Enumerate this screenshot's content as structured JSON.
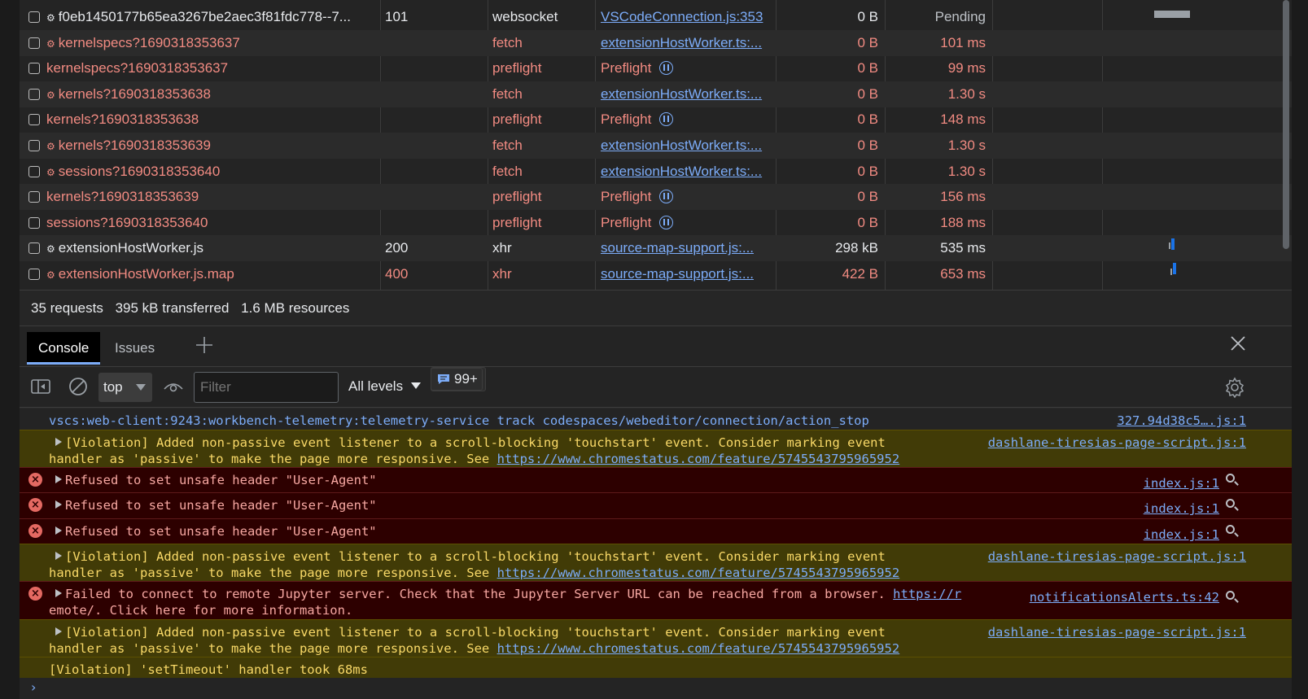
{
  "network": {
    "rows": [
      {
        "name": "f0eb1450177b65ea3267be2aec3f81fdc778--7...",
        "gear": true,
        "status": "101",
        "type": "websocket",
        "initiator": "VSCodeConnection.js:353",
        "initiator_preflight": false,
        "size": "0 B",
        "time": "Pending",
        "error": false
      },
      {
        "name": "kernelspecs?1690318353637",
        "gear": true,
        "status": "",
        "type": "fetch",
        "initiator": "extensionHostWorker.ts:...",
        "initiator_preflight": false,
        "size": "0 B",
        "time": "101 ms",
        "error": true
      },
      {
        "name": "kernelspecs?1690318353637",
        "gear": false,
        "status": "",
        "type": "preflight",
        "initiator": "Preflight",
        "initiator_preflight": true,
        "size": "0 B",
        "time": "99 ms",
        "error": true
      },
      {
        "name": "kernels?1690318353638",
        "gear": true,
        "status": "",
        "type": "fetch",
        "initiator": "extensionHostWorker.ts:...",
        "initiator_preflight": false,
        "size": "0 B",
        "time": "1.30 s",
        "error": true
      },
      {
        "name": "kernels?1690318353638",
        "gear": false,
        "status": "",
        "type": "preflight",
        "initiator": "Preflight",
        "initiator_preflight": true,
        "size": "0 B",
        "time": "148 ms",
        "error": true
      },
      {
        "name": "kernels?1690318353639",
        "gear": true,
        "status": "",
        "type": "fetch",
        "initiator": "extensionHostWorker.ts:...",
        "initiator_preflight": false,
        "size": "0 B",
        "time": "1.30 s",
        "error": true
      },
      {
        "name": "sessions?1690318353640",
        "gear": true,
        "status": "",
        "type": "fetch",
        "initiator": "extensionHostWorker.ts:...",
        "initiator_preflight": false,
        "size": "0 B",
        "time": "1.30 s",
        "error": true
      },
      {
        "name": "kernels?1690318353639",
        "gear": false,
        "status": "",
        "type": "preflight",
        "initiator": "Preflight",
        "initiator_preflight": true,
        "size": "0 B",
        "time": "156 ms",
        "error": true
      },
      {
        "name": "sessions?1690318353640",
        "gear": false,
        "status": "",
        "type": "preflight",
        "initiator": "Preflight",
        "initiator_preflight": true,
        "size": "0 B",
        "time": "188 ms",
        "error": true
      },
      {
        "name": "extensionHostWorker.js",
        "gear": true,
        "status": "200",
        "type": "xhr",
        "initiator": "source-map-support.js:...",
        "initiator_preflight": false,
        "size": "298 kB",
        "time": "535 ms",
        "error": false
      },
      {
        "name": "extensionHostWorker.js.map",
        "gear": true,
        "status": "400",
        "type": "xhr",
        "initiator": "source-map-support.js:...",
        "initiator_preflight": false,
        "size": "422 B",
        "time": "653 ms",
        "error": true
      }
    ]
  },
  "summary": {
    "requests": "35 requests",
    "transferred": "395 kB transferred",
    "resources": "1.6 MB resources"
  },
  "drawer": {
    "tabs": [
      "Console",
      "Issues"
    ],
    "active_tab": "Console",
    "add_tab_icon": "plus-icon",
    "close_icon": "close-icon"
  },
  "toolbar": {
    "context": "top",
    "filter_placeholder": "Filter",
    "levels": "All levels",
    "issues_badge": "99+"
  },
  "console": {
    "messages": [
      {
        "level": "info",
        "lines": [
          "vscs:web-client:9243:workbench-telemetry:telemetry-service track codespaces/webeditor/connection/action_stop"
        ],
        "link": "",
        "source": "327.94d38c5….js:1"
      },
      {
        "level": "warning",
        "lines": [
          "[Violation] Added non-passive event listener to a scroll-blocking 'touchstart' event. Consider marking event",
          "handler as 'passive' to make the page more responsive. See "
        ],
        "link": "https://www.chromestatus.com/feature/5745543795965952",
        "source": "dashlane-tiresias-page-script.js:1"
      },
      {
        "level": "error",
        "lines": [
          "Refused to set unsafe header \"User-Agent\""
        ],
        "link": "",
        "source": "index.js:1"
      },
      {
        "level": "error",
        "lines": [
          "Refused to set unsafe header \"User-Agent\""
        ],
        "link": "",
        "source": "index.js:1"
      },
      {
        "level": "error",
        "lines": [
          "Refused to set unsafe header \"User-Agent\""
        ],
        "link": "",
        "source": "index.js:1"
      },
      {
        "level": "warning",
        "lines": [
          "[Violation] Added non-passive event listener to a scroll-blocking 'touchstart' event. Consider marking event",
          "handler as 'passive' to make the page more responsive. See "
        ],
        "link": "https://www.chromestatus.com/feature/5745543795965952",
        "source": "dashlane-tiresias-page-script.js:1"
      },
      {
        "level": "error",
        "lines": [
          "Failed to connect to remote Jupyter server. Check that the Jupyter Server URL can be reached from a browser. ",
          "emote/. Click here for more information."
        ],
        "link": "https://r",
        "source": "notificationsAlerts.ts:42"
      },
      {
        "level": "warning",
        "lines": [
          "[Violation] Added non-passive event listener to a scroll-blocking 'touchstart' event. Consider marking event",
          "handler as 'passive' to make the page more responsive. See "
        ],
        "link": "https://www.chromestatus.com/feature/5745543795965952",
        "source": "dashlane-tiresias-page-script.js:1"
      },
      {
        "level": "warning",
        "lines": [
          "[Violation] 'setTimeout' handler took 68ms"
        ],
        "link": "",
        "source": ""
      }
    ]
  },
  "colors": {
    "error": "#f28b82",
    "link": "#7cacf8",
    "warning_bg": "#413b07",
    "error_bg": "#2d0000",
    "accent": "#1a73e8"
  }
}
